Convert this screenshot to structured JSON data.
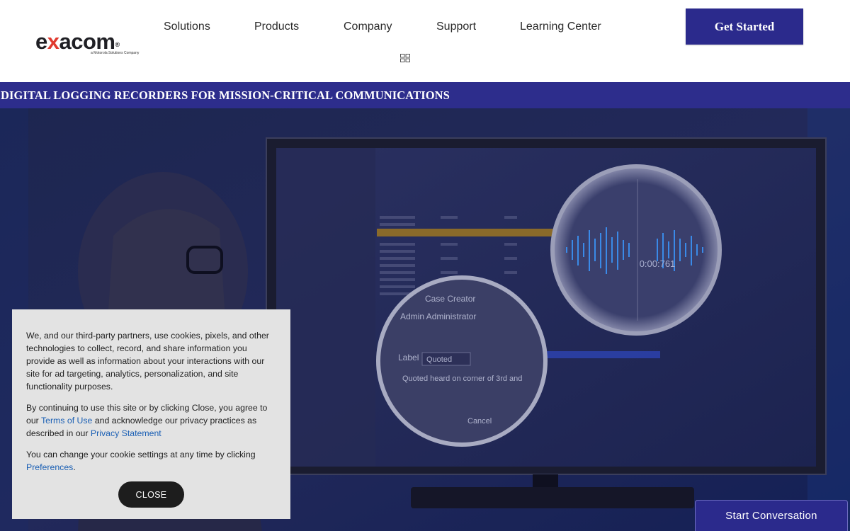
{
  "header": {
    "logo_text_pre": "e",
    "logo_text_x": "x",
    "logo_text_post": "acom",
    "logo_reg": "®",
    "logo_tagline": "a Motorola Solutions Company",
    "nav": [
      {
        "label": "Solutions"
      },
      {
        "label": "Products"
      },
      {
        "label": "Company"
      },
      {
        "label": "Support"
      },
      {
        "label": "Learning Center"
      }
    ],
    "cta_label": "Get Started"
  },
  "banner": {
    "title": "DIGITAL LOGGING RECORDERS FOR MISSION-CRITICAL COMMUNICATIONS"
  },
  "hero": {
    "timer": "0:00:761",
    "popup_row1": "Case Creator",
    "popup_row2": "Admin Administrator",
    "popup_label": "Label",
    "popup_select": "Quoted",
    "popup_note": "Quoted heard on corner of 3rd and",
    "popup_button": "Cancel"
  },
  "cookie": {
    "para1": "We, and our third-party partners, use cookies, pixels, and other technologies to collect, record, and share information you provide as well as information about your interactions with our site for ad targeting, analytics, personalization, and site functionality purposes.",
    "para2_pre": "By continuing to use this site or by clicking Close, you agree to our ",
    "terms_link": "Terms of Use",
    "para2_mid": " and acknowledge our privacy practices as described in our ",
    "privacy_link": "Privacy Statement",
    "para3_pre": "You can change your cookie settings at any time by clicking ",
    "preferences_link": "Preferences",
    "para3_post": ".",
    "close_label": "CLOSE"
  },
  "chat": {
    "label": "Start Conversation"
  },
  "colors": {
    "brand_blue": "#2b2a8c",
    "logo_accent": "#e03a2f",
    "link_blue": "#1a5fb4"
  }
}
